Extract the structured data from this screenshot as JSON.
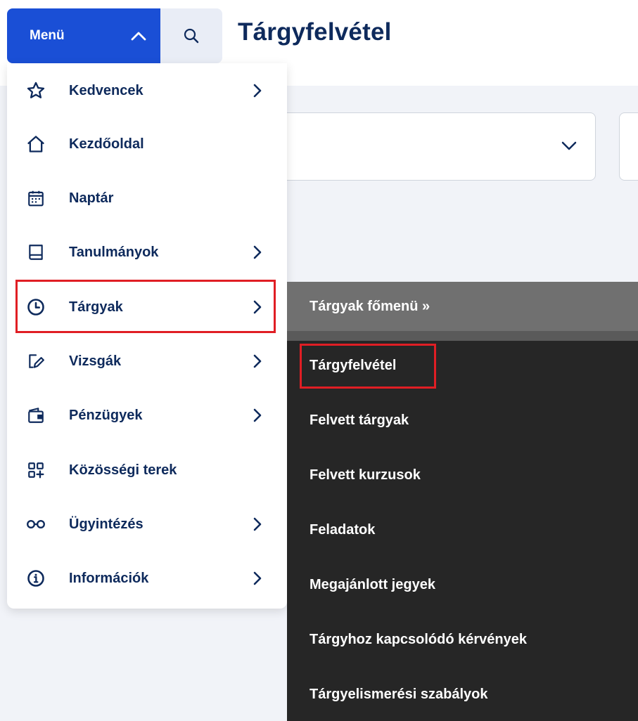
{
  "header": {
    "menu_label": "Menü",
    "page_title": "Tárgyfelvétel"
  },
  "menu": {
    "items": [
      {
        "label": "Kedvencek",
        "icon": "star-icon",
        "has_submenu": true
      },
      {
        "label": "Kezdőoldal",
        "icon": "home-icon",
        "has_submenu": false
      },
      {
        "label": "Naptár",
        "icon": "calendar-icon",
        "has_submenu": false
      },
      {
        "label": "Tanulmányok",
        "icon": "book-icon",
        "has_submenu": true
      },
      {
        "label": "Tárgyak",
        "icon": "clock-icon",
        "has_submenu": true,
        "highlighted": true
      },
      {
        "label": "Vizsgák",
        "icon": "pen-icon",
        "has_submenu": true
      },
      {
        "label": "Pénzügyek",
        "icon": "wallet-icon",
        "has_submenu": true
      },
      {
        "label": "Közösségi terek",
        "icon": "grid-plus-icon",
        "has_submenu": false
      },
      {
        "label": "Ügyintézés",
        "icon": "glasses-icon",
        "has_submenu": true
      },
      {
        "label": "Információk",
        "icon": "info-icon",
        "has_submenu": true
      }
    ]
  },
  "submenu": {
    "header": "Tárgyak főmenü »",
    "items": [
      {
        "label": "Tárgyfelvétel",
        "highlighted": true
      },
      {
        "label": "Felvett tárgyak"
      },
      {
        "label": "Felvett kurzusok"
      },
      {
        "label": "Feladatok"
      },
      {
        "label": "Megajánlott jegyek"
      },
      {
        "label": "Tárgyhoz kapcsolódó kérvények"
      },
      {
        "label": "Tárgyelismerési szabályok"
      }
    ]
  },
  "colors": {
    "primary": "#1a4fd6",
    "title": "#0e2a5c",
    "highlight": "#e01e24",
    "submenu_bg": "#262626",
    "submenu_header_bg": "#707070"
  }
}
